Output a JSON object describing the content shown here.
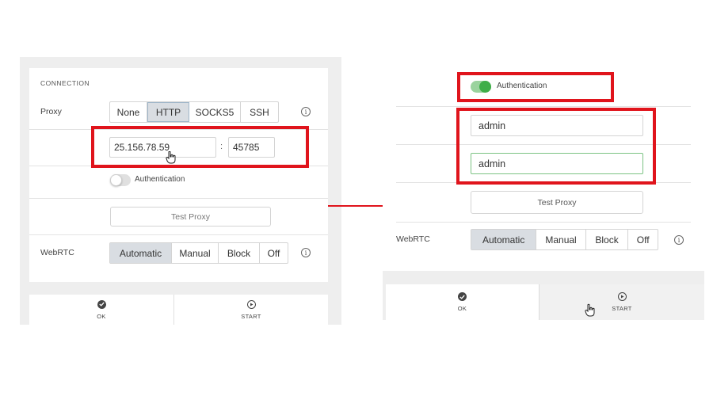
{
  "left": {
    "section_title": "CONNECTION",
    "proxy_label": "Proxy",
    "proxy_options": [
      "None",
      "HTTP",
      "SOCKS5",
      "SSH"
    ],
    "proxy_selected": "HTTP",
    "host_value": "25.156.78.59",
    "port_separator": ":",
    "port_value": "45785",
    "auth_label": "Authentication",
    "auth_enabled": false,
    "test_proxy_label": "Test Proxy",
    "webrtc_label": "WebRTC",
    "webrtc_options": [
      "Automatic",
      "Manual",
      "Block",
      "Off"
    ],
    "webrtc_selected": "Automatic",
    "info_glyph": "i",
    "ok_label": "OK",
    "start_label": "START"
  },
  "right": {
    "auth_label": "Authentication",
    "auth_enabled": true,
    "username_value": "admin",
    "password_value": "admin",
    "test_proxy_label": "Test Proxy",
    "webrtc_label": "WebRTC",
    "webrtc_options": [
      "Automatic",
      "Manual",
      "Block",
      "Off"
    ],
    "webrtc_selected": "Automatic",
    "info_glyph": "i",
    "ok_label": "OK",
    "start_label": "START"
  },
  "colors": {
    "highlight_red": "#e0141c",
    "toggle_on": "#3fae49",
    "focused_input_border": "#7cc383",
    "selected_segment": "#d9dde2"
  },
  "icons": {
    "ok": "check-circle-icon",
    "start": "play-circle-icon",
    "info": "info-icon",
    "cursor": "hand-pointer-icon",
    "arrow": "right-arrow-icon"
  }
}
